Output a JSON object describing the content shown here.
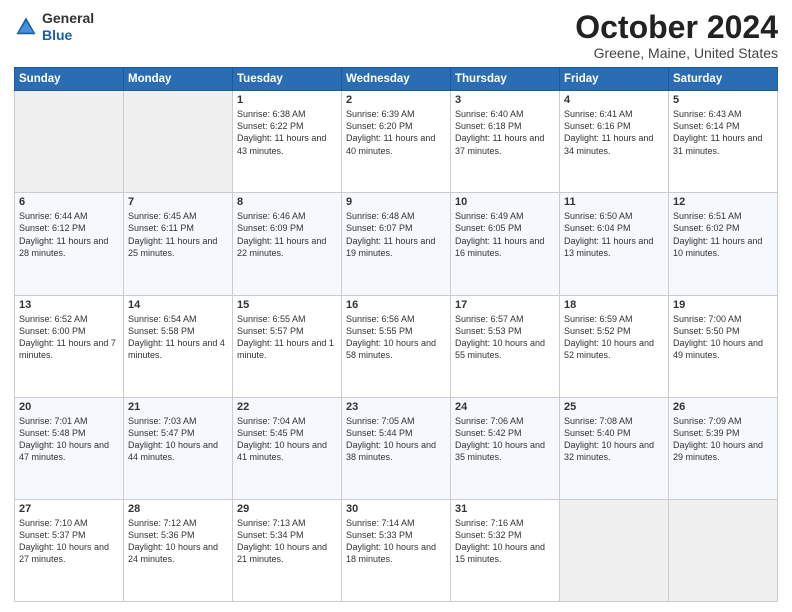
{
  "logo": {
    "general": "General",
    "blue": "Blue"
  },
  "header": {
    "month": "October 2024",
    "location": "Greene, Maine, United States"
  },
  "days_of_week": [
    "Sunday",
    "Monday",
    "Tuesday",
    "Wednesday",
    "Thursday",
    "Friday",
    "Saturday"
  ],
  "weeks": [
    [
      {
        "day": "",
        "empty": true
      },
      {
        "day": "",
        "empty": true
      },
      {
        "day": "1",
        "sunrise": "6:38 AM",
        "sunset": "6:22 PM",
        "daylight": "11 hours and 43 minutes."
      },
      {
        "day": "2",
        "sunrise": "6:39 AM",
        "sunset": "6:20 PM",
        "daylight": "11 hours and 40 minutes."
      },
      {
        "day": "3",
        "sunrise": "6:40 AM",
        "sunset": "6:18 PM",
        "daylight": "11 hours and 37 minutes."
      },
      {
        "day": "4",
        "sunrise": "6:41 AM",
        "sunset": "6:16 PM",
        "daylight": "11 hours and 34 minutes."
      },
      {
        "day": "5",
        "sunrise": "6:43 AM",
        "sunset": "6:14 PM",
        "daylight": "11 hours and 31 minutes."
      }
    ],
    [
      {
        "day": "6",
        "sunrise": "6:44 AM",
        "sunset": "6:12 PM",
        "daylight": "11 hours and 28 minutes."
      },
      {
        "day": "7",
        "sunrise": "6:45 AM",
        "sunset": "6:11 PM",
        "daylight": "11 hours and 25 minutes."
      },
      {
        "day": "8",
        "sunrise": "6:46 AM",
        "sunset": "6:09 PM",
        "daylight": "11 hours and 22 minutes."
      },
      {
        "day": "9",
        "sunrise": "6:48 AM",
        "sunset": "6:07 PM",
        "daylight": "11 hours and 19 minutes."
      },
      {
        "day": "10",
        "sunrise": "6:49 AM",
        "sunset": "6:05 PM",
        "daylight": "11 hours and 16 minutes."
      },
      {
        "day": "11",
        "sunrise": "6:50 AM",
        "sunset": "6:04 PM",
        "daylight": "11 hours and 13 minutes."
      },
      {
        "day": "12",
        "sunrise": "6:51 AM",
        "sunset": "6:02 PM",
        "daylight": "11 hours and 10 minutes."
      }
    ],
    [
      {
        "day": "13",
        "sunrise": "6:52 AM",
        "sunset": "6:00 PM",
        "daylight": "11 hours and 7 minutes."
      },
      {
        "day": "14",
        "sunrise": "6:54 AM",
        "sunset": "5:58 PM",
        "daylight": "11 hours and 4 minutes."
      },
      {
        "day": "15",
        "sunrise": "6:55 AM",
        "sunset": "5:57 PM",
        "daylight": "11 hours and 1 minute."
      },
      {
        "day": "16",
        "sunrise": "6:56 AM",
        "sunset": "5:55 PM",
        "daylight": "10 hours and 58 minutes."
      },
      {
        "day": "17",
        "sunrise": "6:57 AM",
        "sunset": "5:53 PM",
        "daylight": "10 hours and 55 minutes."
      },
      {
        "day": "18",
        "sunrise": "6:59 AM",
        "sunset": "5:52 PM",
        "daylight": "10 hours and 52 minutes."
      },
      {
        "day": "19",
        "sunrise": "7:00 AM",
        "sunset": "5:50 PM",
        "daylight": "10 hours and 49 minutes."
      }
    ],
    [
      {
        "day": "20",
        "sunrise": "7:01 AM",
        "sunset": "5:48 PM",
        "daylight": "10 hours and 47 minutes."
      },
      {
        "day": "21",
        "sunrise": "7:03 AM",
        "sunset": "5:47 PM",
        "daylight": "10 hours and 44 minutes."
      },
      {
        "day": "22",
        "sunrise": "7:04 AM",
        "sunset": "5:45 PM",
        "daylight": "10 hours and 41 minutes."
      },
      {
        "day": "23",
        "sunrise": "7:05 AM",
        "sunset": "5:44 PM",
        "daylight": "10 hours and 38 minutes."
      },
      {
        "day": "24",
        "sunrise": "7:06 AM",
        "sunset": "5:42 PM",
        "daylight": "10 hours and 35 minutes."
      },
      {
        "day": "25",
        "sunrise": "7:08 AM",
        "sunset": "5:40 PM",
        "daylight": "10 hours and 32 minutes."
      },
      {
        "day": "26",
        "sunrise": "7:09 AM",
        "sunset": "5:39 PM",
        "daylight": "10 hours and 29 minutes."
      }
    ],
    [
      {
        "day": "27",
        "sunrise": "7:10 AM",
        "sunset": "5:37 PM",
        "daylight": "10 hours and 27 minutes."
      },
      {
        "day": "28",
        "sunrise": "7:12 AM",
        "sunset": "5:36 PM",
        "daylight": "10 hours and 24 minutes."
      },
      {
        "day": "29",
        "sunrise": "7:13 AM",
        "sunset": "5:34 PM",
        "daylight": "10 hours and 21 minutes."
      },
      {
        "day": "30",
        "sunrise": "7:14 AM",
        "sunset": "5:33 PM",
        "daylight": "10 hours and 18 minutes."
      },
      {
        "day": "31",
        "sunrise": "7:16 AM",
        "sunset": "5:32 PM",
        "daylight": "10 hours and 15 minutes."
      },
      {
        "day": "",
        "empty": true
      },
      {
        "day": "",
        "empty": true
      }
    ]
  ],
  "labels": {
    "sunrise": "Sunrise:",
    "sunset": "Sunset:",
    "daylight": "Daylight:"
  }
}
